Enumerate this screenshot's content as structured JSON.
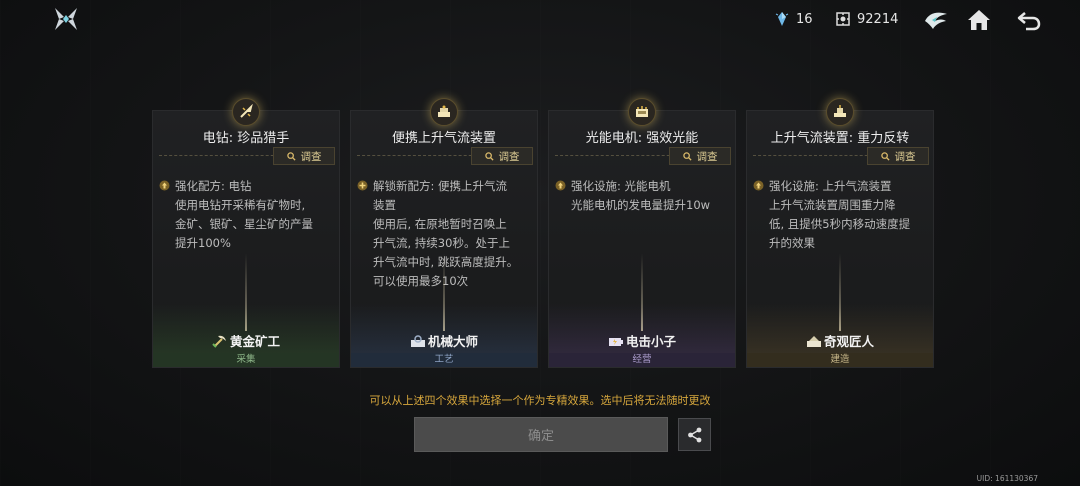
{
  "topbar": {
    "resource_a": {
      "icon": "crystal-icon",
      "value": "16",
      "color": "#6fb8e8"
    },
    "resource_b": {
      "icon": "gear-token-icon",
      "value": "92214"
    },
    "icons": [
      "faction-emblem-icon",
      "home-icon",
      "back-arrow-icon"
    ]
  },
  "cards": [
    {
      "title": "电钻: 珍品猎手",
      "inspect": "调查",
      "desc": "强化配方: 电钻\n使用电钻开采稀有矿物时,\n金矿、银矿、星尘矿的产量\n提升100%",
      "role": "黄金矿工",
      "category": "采集",
      "badge_icon": "drill-icon"
    },
    {
      "title": "便携上升气流装置",
      "inspect": "调查",
      "desc": "解锁新配方: 便携上升气流\n装置\n使用后, 在原地暂时召唤上\n升气流, 持续30秒。处于上\n升气流中时, 跳跃高度提升。\n可以使用最多10次",
      "role": "机械大师",
      "category": "工艺",
      "badge_icon": "machine-icon"
    },
    {
      "title": "光能电机: 强效光能",
      "inspect": "调查",
      "desc": "强化设施: 光能电机\n光能电机的发电量提升10w",
      "role": "电击小子",
      "category": "经营",
      "badge_icon": "generator-icon"
    },
    {
      "title": "上升气流装置: 重力反转",
      "inspect": "调查",
      "desc": "强化设施: 上升气流装置\n上升气流装置周围重力降\n低, 且提供5秒内移动速度提\n升的效果",
      "role": "奇观匠人",
      "category": "建造",
      "badge_icon": "device-icon"
    }
  ],
  "hint": "可以从上述四个效果中选择一个作为专精效果。选中后将无法随时更改",
  "confirm_label": "确定",
  "uid": "UID: 161130367"
}
